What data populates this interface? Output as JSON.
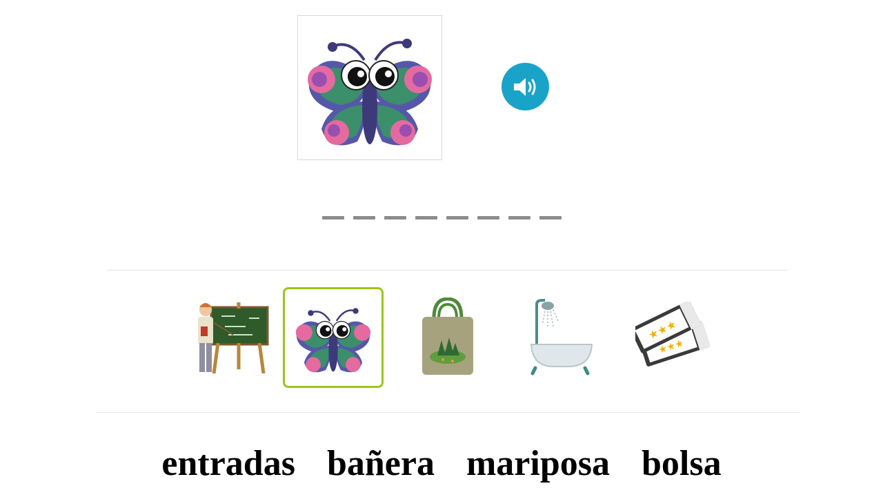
{
  "prompt": {
    "image": "butterfly",
    "audio_icon": "speaker-icon",
    "blank_count": 8
  },
  "choices": [
    {
      "image": "teacher-at-chalkboard",
      "selected": false
    },
    {
      "image": "butterfly",
      "selected": true
    },
    {
      "image": "tote-bag",
      "selected": false
    },
    {
      "image": "bathtub-shower",
      "selected": false
    },
    {
      "image": "tickets",
      "selected": false
    }
  ],
  "words": [
    "entradas",
    "bañera",
    "mariposa",
    "bolsa"
  ],
  "colors": {
    "audio_button": "#1aa3c8",
    "selected_border": "#9cc51c",
    "blank": "#8c8c8c"
  }
}
